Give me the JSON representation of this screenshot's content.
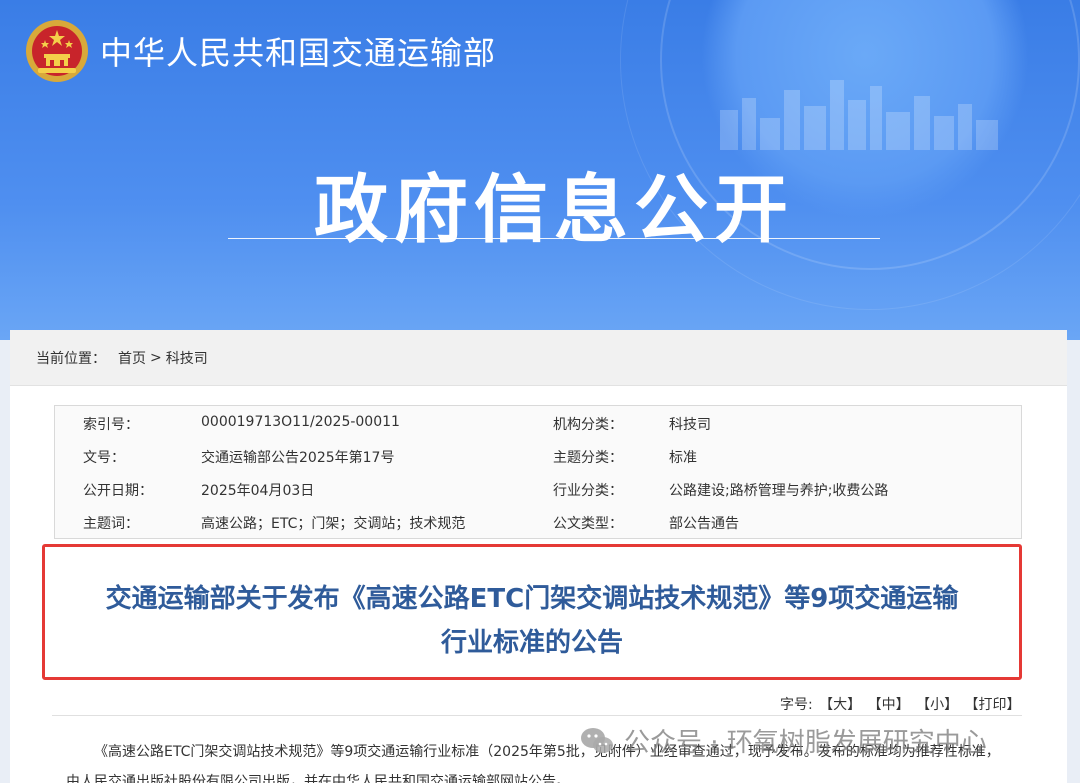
{
  "header": {
    "ministry_name": "中华人民共和国交通运输部",
    "banner_title": "政府信息公开"
  },
  "breadcrumb": {
    "label": "当前位置：",
    "home": "首页",
    "separator": ">",
    "current": "科技司"
  },
  "meta": {
    "rows": [
      {
        "k1": "索引号：",
        "v1": "000019713O11/2025-00011",
        "k2": "机构分类：",
        "v2": "科技司"
      },
      {
        "k1": "文号：",
        "v1": "交通运输部公告2025年第17号",
        "k2": "主题分类：",
        "v2": "标准"
      },
      {
        "k1": "公开日期：",
        "v1": "2025年04月03日",
        "k2": "行业分类：",
        "v2": "公路建设;路桥管理与养护;收费公路"
      },
      {
        "k1": "主题词：",
        "v1": "高速公路；ETC；门架；交调站；技术规范",
        "k2": "公文类型：",
        "v2": "部公告通告"
      }
    ]
  },
  "notice": {
    "title_line1": "交通运输部关于发布《高速公路ETC门架交调站技术规范》等9项交通运输",
    "title_line2": "行业标准的公告"
  },
  "font_size": {
    "label": "字号:",
    "large": "【大】",
    "medium": "【中】",
    "small": "【小】",
    "print": "【打印】"
  },
  "body": {
    "paragraph": "《高速公路ETC门架交调站技术规范》等9项交通运输行业标准（2025年第5批，见附件）业经审查通过，现予发布。发布的标准均为推荐性标准，由人民交通出版社股份有限公司出版，并在中华人民共和国交通运输部网站公告。"
  },
  "watermark": {
    "text": "公众号 · 环氧树脂发展研究中心",
    "icon": "wechat-icon"
  },
  "colors": {
    "banner_blue": "#3a7de6",
    "title_blue": "#2f5b9a",
    "highlight_red": "#e53935"
  }
}
